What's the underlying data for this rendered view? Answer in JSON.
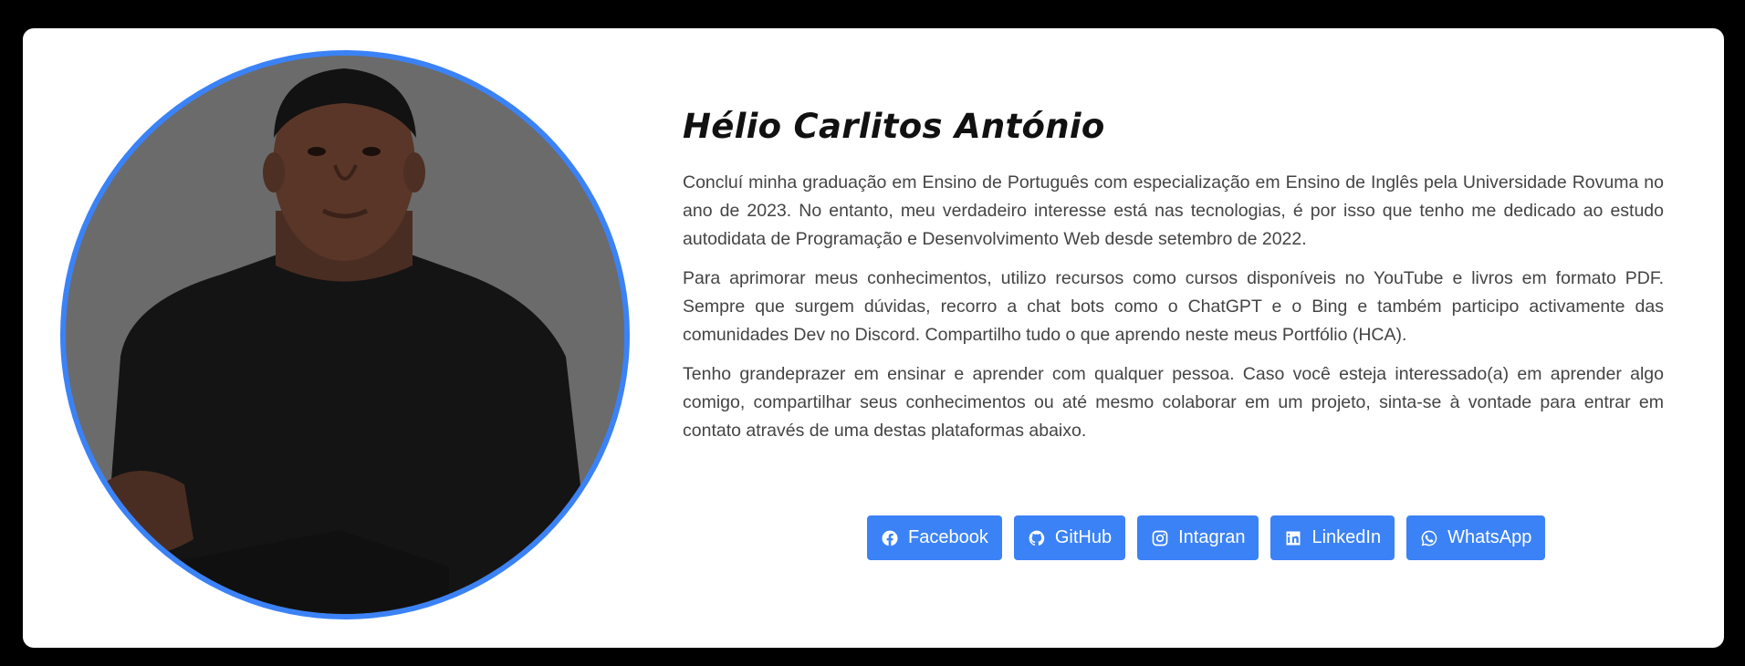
{
  "profile": {
    "name": "Hélio Carlitos António",
    "paragraphs": [
      "Concluí minha graduação em Ensino de Português com especialização em Ensino de Inglês pela Universidade Rovuma no ano de 2023. No entanto, meu verdadeiro interesse está nas tecnologias, é por isso que tenho me dedicado ao estudo autodidata de Programação e Desenvolvimento Web desde setembro de 2022.",
      "Para aprimorar meus conhecimentos, utilizo recursos como cursos disponíveis no YouTube e livros em formato PDF. Sempre que surgem dúvidas, recorro a chat bots como o ChatGPT e o Bing e também participo activamente das comunidades Dev no Discord. Compartilho tudo o que aprendo neste meus Portfólio (HCA).",
      "Tenho grandeprazer em ensinar e aprender com qualquer pessoa. Caso você esteja interessado(a) em aprender algo comigo, compartilhar seus conhecimentos ou até mesmo colaborar em um projeto, sinta-se à vontade para entrar em contato através de uma destas plataformas abaixo."
    ]
  },
  "socials": [
    {
      "label": "Facebook",
      "icon": "facebook-icon"
    },
    {
      "label": "GitHub",
      "icon": "github-icon"
    },
    {
      "label": "Intagran",
      "icon": "instagram-icon"
    },
    {
      "label": "LinkedIn",
      "icon": "linkedin-icon"
    },
    {
      "label": "WhatsApp",
      "icon": "whatsapp-icon"
    }
  ],
  "colors": {
    "accent": "#3b82f6",
    "background": "#000000",
    "card": "#ffffff",
    "photo_background": "#6b6b6b"
  }
}
